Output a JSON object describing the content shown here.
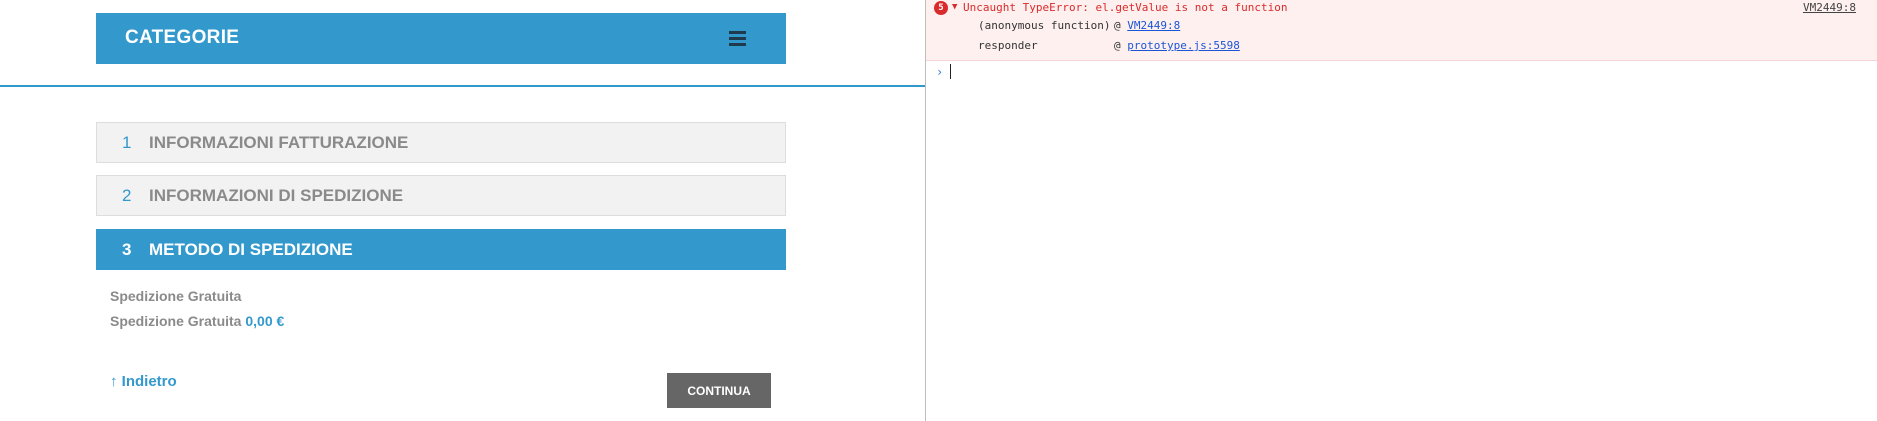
{
  "header": {
    "title": "CATEGORIE",
    "menu_icon": "hamburger-menu-icon"
  },
  "steps": [
    {
      "number": "1",
      "label": "INFORMAZIONI FATTURAZIONE",
      "active": false
    },
    {
      "number": "2",
      "label": "INFORMAZIONI DI SPEDIZIONE",
      "active": false
    },
    {
      "number": "3",
      "label": "METODO DI SPEDIZIONE",
      "active": true
    }
  ],
  "shipping": {
    "method_title": "Spedizione Gratuita",
    "option_label": "Spedizione Gratuita",
    "option_price": "0,00 €"
  },
  "actions": {
    "back_label": "↑ Indietro",
    "continue_label": "CONTINUA"
  },
  "console": {
    "error_count": "5",
    "error_message": "Uncaught TypeError: el.getValue is not a function",
    "error_source": "VM2449:8",
    "stack": [
      {
        "fn": "(anonymous function)",
        "at": "@",
        "link": "VM2449:8"
      },
      {
        "fn": "responder",
        "at": "@",
        "link": "prototype.js:5598"
      }
    ],
    "prompt_symbol": "›"
  },
  "colors": {
    "accent": "#3399cc",
    "step_inactive_bg": "#f2f2f2",
    "button_bg": "#666666",
    "error_red": "#d92b2b",
    "error_bg": "#fff0f0"
  }
}
